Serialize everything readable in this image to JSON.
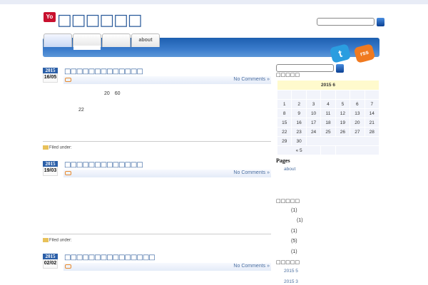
{
  "site": {
    "logo": "Yo",
    "title": "□□□□□□",
    "search_value": ""
  },
  "nav": {
    "tabs": [
      "",
      "",
      "",
      "about"
    ]
  },
  "social": {
    "twitter": "t",
    "rss": "rss"
  },
  "posts": [
    {
      "year": "2015",
      "day": "16/05",
      "title": "□□□□□□□□□□□□□",
      "comments": "No Comments »",
      "body": [
        "20　60",
        "22"
      ],
      "filed": "Filed under:"
    },
    {
      "year": "2015",
      "day": "19/03",
      "title": "□□□□□□□□□□□□□",
      "comments": "No Comments »",
      "body": [],
      "filed": "Filed under:"
    },
    {
      "year": "2015",
      "day": "02/02",
      "title": "□□□□□□□□□□□□□□□",
      "comments": "No Comments »"
    }
  ],
  "sidebar": {
    "search_value": "",
    "calendar_heading": "□□□□□",
    "calendar": {
      "caption": "2015 6",
      "weekdays": [
        "",
        "",
        "",
        "",
        "",
        "",
        ""
      ],
      "weeks": [
        [
          "1",
          "2",
          "3",
          "4",
          "5",
          "6",
          "7"
        ],
        [
          "8",
          "9",
          "10",
          "11",
          "12",
          "13",
          "14"
        ],
        [
          "15",
          "16",
          "17",
          "18",
          "19",
          "20",
          "21"
        ],
        [
          "22",
          "23",
          "24",
          "25",
          "26",
          "27",
          "28"
        ],
        [
          "29",
          "30",
          "",
          "",
          "",
          "",
          ""
        ]
      ],
      "prev": "« 5"
    },
    "pages_heading": "Pages",
    "pages": [
      "about"
    ],
    "categories_heading": "□□□□□",
    "categories": [
      "(1)",
      "(1)",
      "(1)",
      "(5)",
      "(1)"
    ],
    "archives_heading": "□□□□□",
    "archives": [
      "2015 5",
      "2015 3"
    ]
  }
}
